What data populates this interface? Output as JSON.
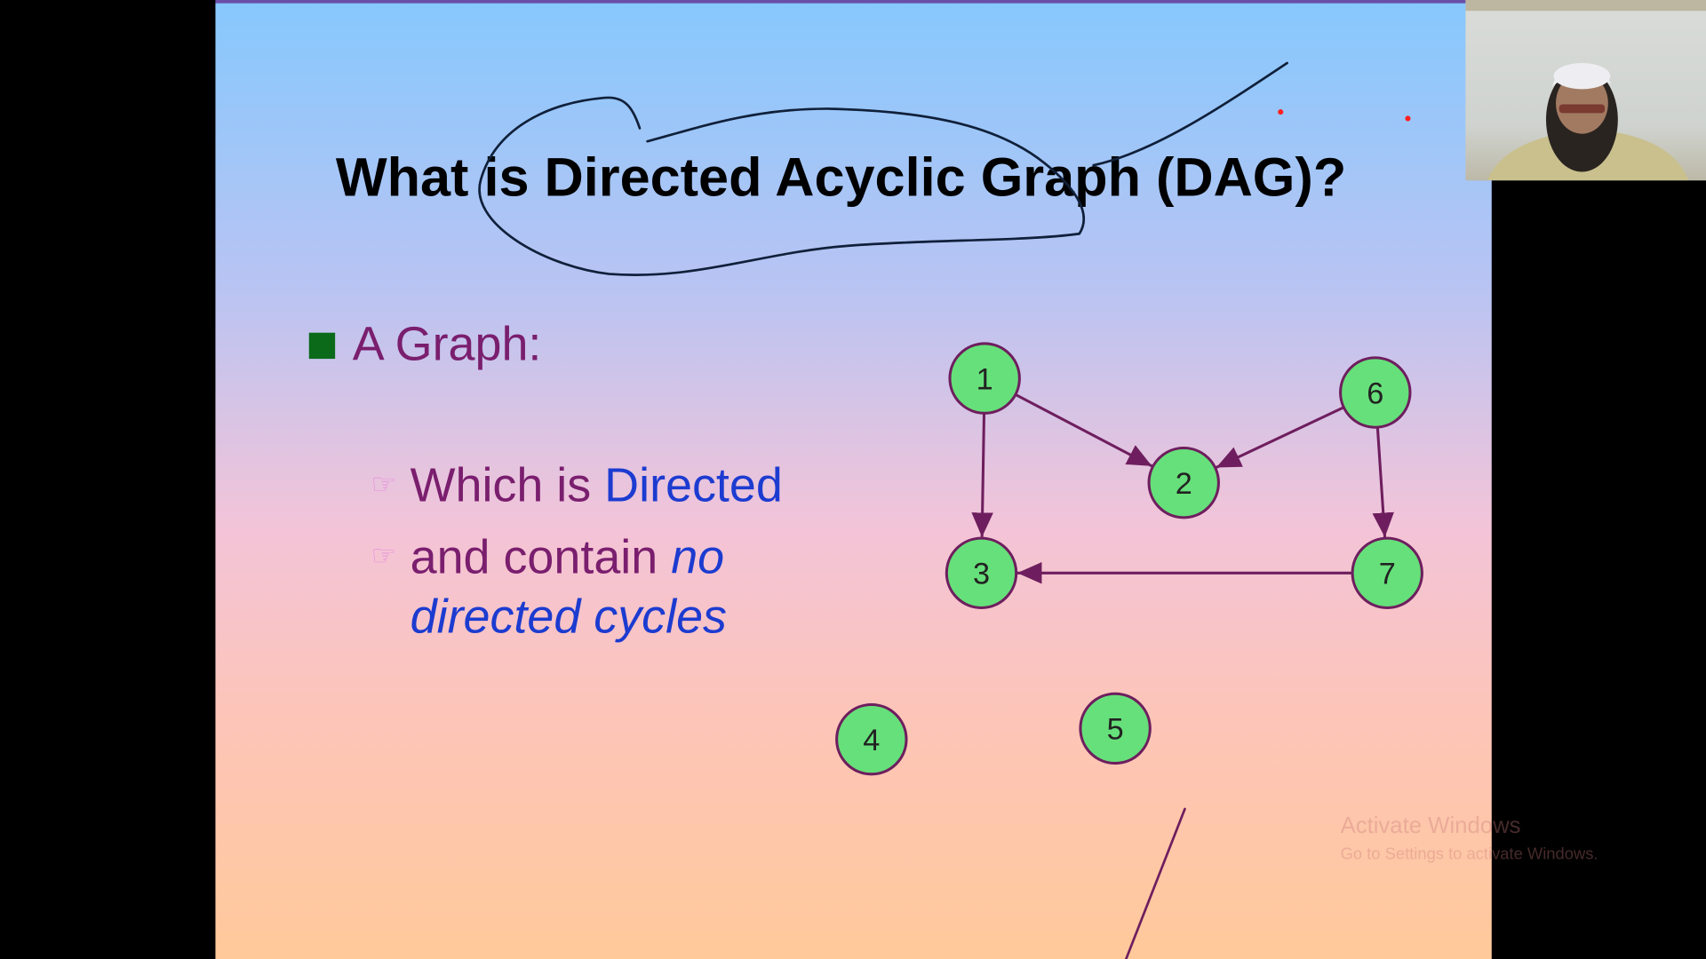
{
  "slide": {
    "title": "What is Directed Acyclic Graph (DAG)?",
    "bullet": "A Graph:",
    "sub1_prefix": "Which is ",
    "sub1_emph": "Directed",
    "sub2_prefix": "and contain ",
    "sub2_emph": "no",
    "sub2_line2": "directed cycles",
    "hand_icon": "☞"
  },
  "graph": {
    "nodes": [
      "1",
      "2",
      "3",
      "4",
      "5",
      "6",
      "7"
    ],
    "edges": [
      [
        "1",
        "2"
      ],
      [
        "6",
        "2"
      ],
      [
        "1",
        "3"
      ],
      [
        "6",
        "7"
      ],
      [
        "7",
        "3"
      ]
    ],
    "node_color": "#66e07a",
    "edge_color": "#6e1e5e"
  },
  "watermark": {
    "line1": "Activate Windows",
    "line2": "Go to Settings to activate Windows."
  },
  "colors": {
    "bullet": "#0a6a1a",
    "text": "#7a1e6e",
    "emphasis": "#1c3bd0",
    "ink": "#10203a",
    "pointer": "#ff2020"
  }
}
